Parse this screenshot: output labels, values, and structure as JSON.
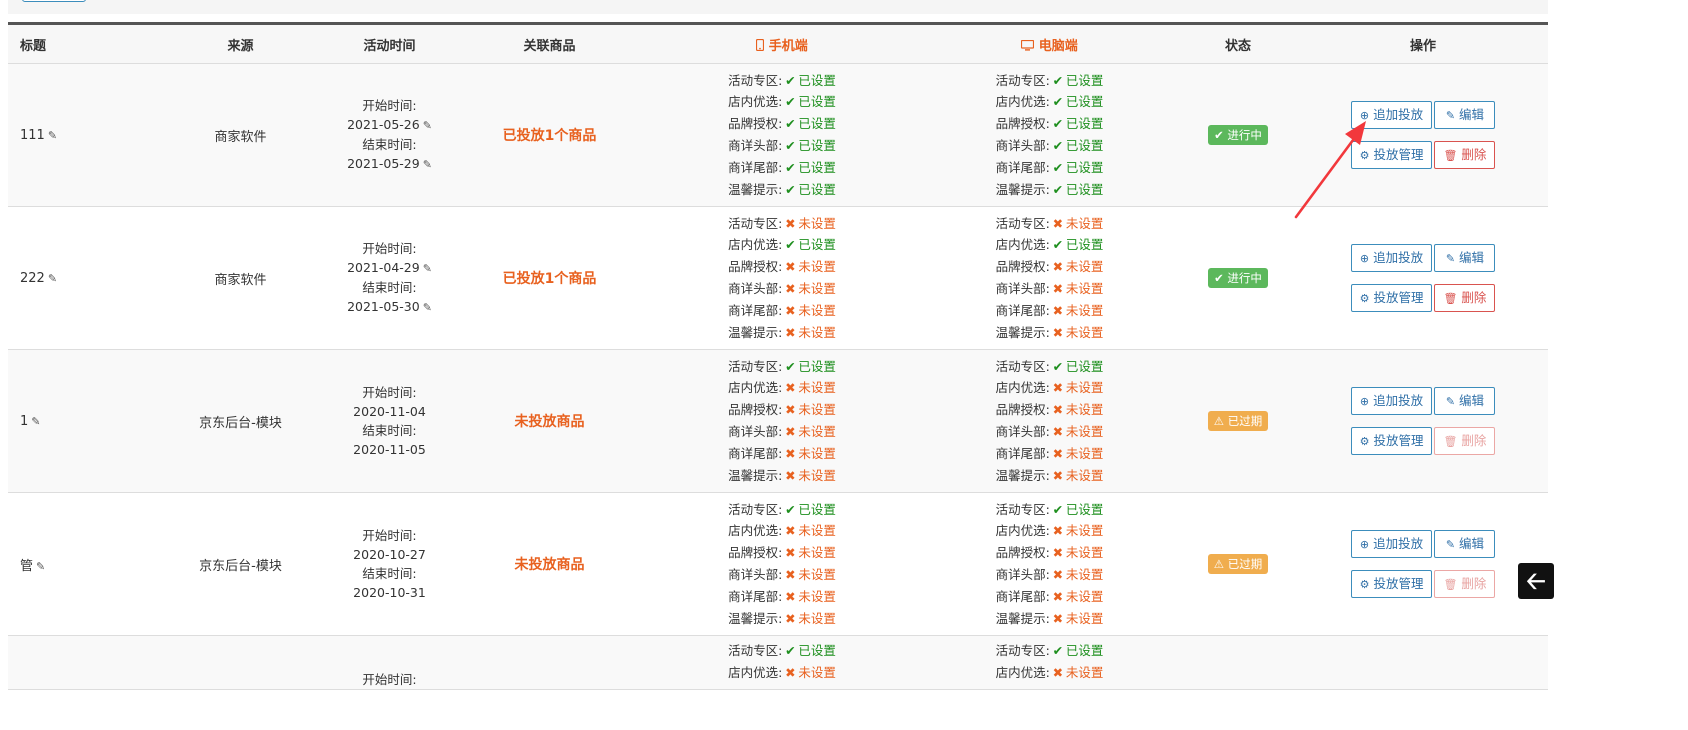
{
  "header": {
    "title": "标题",
    "source": "来源",
    "time": "活动时间",
    "linked": "关联商品",
    "mobile": "手机端",
    "pc": "电脑端",
    "status": "状态",
    "ops": "操作"
  },
  "icons": {
    "mobile": "mobile-icon",
    "pc": "desktop-icon",
    "edit": "edit-icon",
    "ok": "check-icon",
    "no": "cross-icon"
  },
  "colors": {
    "accent": "#e8611f",
    "ok": "#1e8f1e",
    "running": "#5cb85c",
    "expired": "#f0ad4e",
    "primary": "#3c8dbc",
    "danger": "#d9534f"
  },
  "labels": {
    "start": "开始时间:",
    "end": "结束时间:",
    "set": "已设置",
    "unset": "未设置",
    "cfg_items": [
      "活动专区:",
      "店内优选:",
      "品牌授权:",
      "商详头部:",
      "商详尾部:",
      "温馨提示:"
    ],
    "btn_add": "追加投放",
    "btn_edit": "编辑",
    "btn_manage": "投放管理",
    "btn_delete": "删除"
  },
  "rows": [
    {
      "title": "111",
      "source": "商家软件",
      "start": "2021-05-26",
      "end": "2021-05-29",
      "time_editable": true,
      "linked": "已投放1个商品",
      "status": "进行中",
      "status_type": "running",
      "delete_enabled": true,
      "mobile": [
        true,
        true,
        true,
        true,
        true,
        true
      ],
      "pc": [
        true,
        true,
        true,
        true,
        true,
        true
      ]
    },
    {
      "title": "222",
      "source": "商家软件",
      "start": "2021-04-29",
      "end": "2021-05-30",
      "time_editable": true,
      "linked": "已投放1个商品",
      "status": "进行中",
      "status_type": "running",
      "delete_enabled": true,
      "mobile": [
        false,
        true,
        false,
        false,
        false,
        false
      ],
      "pc": [
        false,
        true,
        false,
        false,
        false,
        false
      ]
    },
    {
      "title": "1",
      "source": "京东后台-模块",
      "start": "2020-11-04",
      "end": "2020-11-05",
      "time_editable": false,
      "linked": "未投放商品",
      "status": "已过期",
      "status_type": "expired",
      "delete_enabled": false,
      "mobile": [
        true,
        false,
        false,
        false,
        false,
        false
      ],
      "pc": [
        true,
        false,
        false,
        false,
        false,
        false
      ]
    },
    {
      "title": "管",
      "source": "京东后台-模块",
      "start": "2020-10-27",
      "end": "2020-10-31",
      "time_editable": false,
      "linked": "未投放商品",
      "status": "已过期",
      "status_type": "expired",
      "delete_enabled": false,
      "mobile": [
        true,
        false,
        false,
        false,
        false,
        false
      ],
      "pc": [
        true,
        false,
        false,
        false,
        false,
        false
      ]
    }
  ],
  "partial_row": {
    "start_label": "开始时间:",
    "mobile": [
      true,
      false
    ],
    "pc": [
      true,
      false
    ]
  }
}
